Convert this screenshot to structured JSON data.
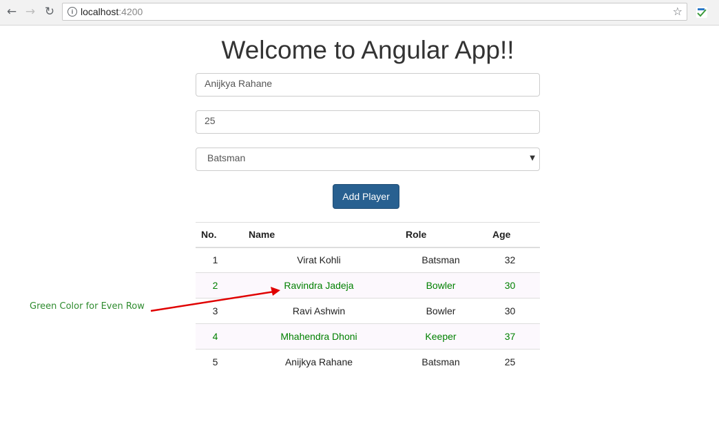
{
  "browser": {
    "back_icon": "back-arrow-icon",
    "forward_icon": "forward-arrow-icon",
    "reload_icon": "reload-icon",
    "url_host": "localhost",
    "url_port": ":4200"
  },
  "page": {
    "title": "Welcome to Angular App!!"
  },
  "form": {
    "name_value": "Anijkya Rahane",
    "age_value": "25",
    "role_selected": "Batsman",
    "add_button_label": "Add Player"
  },
  "table": {
    "headers": [
      "No.",
      "Name",
      "Role",
      "Age"
    ],
    "rows": [
      {
        "no": "1",
        "name": "Virat Kohli",
        "role": "Batsman",
        "age": "32"
      },
      {
        "no": "2",
        "name": "Ravindra Jadeja",
        "role": "Bowler",
        "age": "30"
      },
      {
        "no": "3",
        "name": "Ravi Ashwin",
        "role": "Bowler",
        "age": "30"
      },
      {
        "no": "4",
        "name": "Mhahendra Dhoni",
        "role": "Keeper",
        "age": "37"
      },
      {
        "no": "5",
        "name": "Anijkya Rahane",
        "role": "Batsman",
        "age": "25"
      }
    ],
    "even_row_color": "#008000"
  },
  "annotation": {
    "text": "Green Color for Even Row",
    "color": "#e00000"
  }
}
